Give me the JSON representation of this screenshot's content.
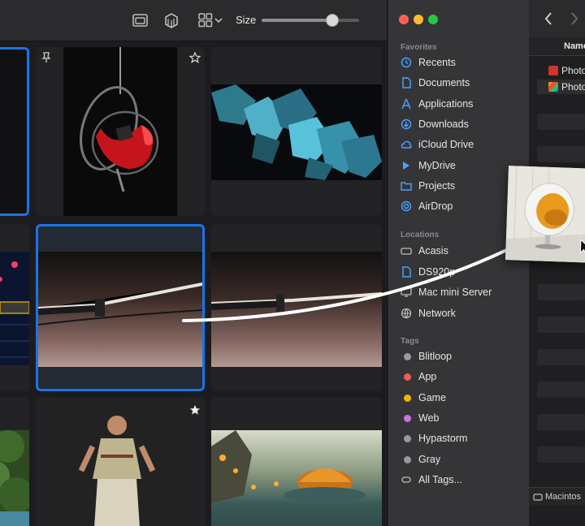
{
  "toolbar": {
    "size_label": "Size",
    "size_slider_value": 0.72,
    "icons": [
      "window-icon",
      "cube-icon",
      "grid-icon",
      "chevron-down-icon"
    ]
  },
  "grid": {
    "accent_color": "#1a74e8",
    "tiles": [
      {
        "name": "tile-partial-top",
        "selected": true
      },
      {
        "name": "tile-egg-chair",
        "pinned": true,
        "starred": true
      },
      {
        "name": "tile-crystals"
      },
      {
        "name": "tile-sci-fi-hex"
      },
      {
        "name": "tile-katana-selected",
        "selected": true
      },
      {
        "name": "tile-katana"
      },
      {
        "name": "tile-forest"
      },
      {
        "name": "tile-chef",
        "starred": true
      },
      {
        "name": "tile-lantern-island"
      }
    ]
  },
  "finder": {
    "favorites_header": "Favorites",
    "favorites": [
      {
        "label": "Recents",
        "icon": "clock-icon"
      },
      {
        "label": "Documents",
        "icon": "document-icon"
      },
      {
        "label": "Applications",
        "icon": "applications-icon"
      },
      {
        "label": "Downloads",
        "icon": "download-icon"
      },
      {
        "label": "iCloud Drive",
        "icon": "cloud-icon"
      },
      {
        "label": "MyDrive",
        "icon": "drive-icon"
      },
      {
        "label": "Projects",
        "icon": "folder-icon"
      },
      {
        "label": "AirDrop",
        "icon": "airdrop-icon"
      }
    ],
    "locations_header": "Locations",
    "locations": [
      {
        "label": "Acasis",
        "icon": "disk-icon"
      },
      {
        "label": "DS920p",
        "icon": "document-icon"
      },
      {
        "label": "Mac mini Server",
        "icon": "display-icon"
      },
      {
        "label": "Network",
        "icon": "globe-icon"
      }
    ],
    "tags_header": "Tags",
    "tags": [
      {
        "label": "Blitloop",
        "color": "#9a9a9e"
      },
      {
        "label": "App",
        "color": "#f25c5c"
      },
      {
        "label": "Game",
        "color": "#f5b400"
      },
      {
        "label": "Web",
        "color": "#cf6ee6"
      },
      {
        "label": "Hypastorm",
        "color": "#9a9a9e"
      },
      {
        "label": "Gray",
        "color": "#9a9a9e"
      },
      {
        "label": "All Tags...",
        "color": ""
      }
    ],
    "column_header": "Name",
    "files": [
      "Photo",
      "Photo"
    ],
    "pathbar": "Macintos",
    "traffic_lights": [
      "#ff5f57",
      "#febc2e",
      "#28c840"
    ]
  }
}
